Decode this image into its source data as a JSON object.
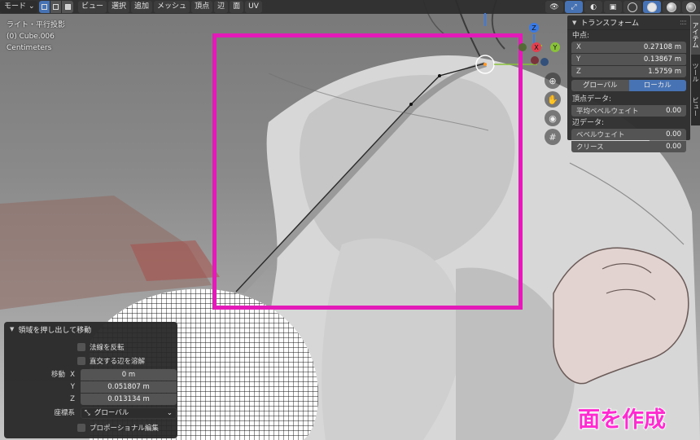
{
  "header": {
    "mode_label": "モード",
    "menus": [
      "ビュー",
      "選択",
      "追加",
      "メッシュ",
      "頂点",
      "辺",
      "面",
      "UV"
    ]
  },
  "viewport_info": {
    "view_name": "ライト・平行投影",
    "object": "(0) Cube.006",
    "units": "Centimeters"
  },
  "gizmo": {
    "axes": [
      "X",
      "Y",
      "Z"
    ],
    "colors": {
      "x": "#e2404f",
      "y": "#89c23a",
      "z": "#3a7ae5"
    }
  },
  "nav_icons": [
    "zoom-icon",
    "hand-icon",
    "camera-icon",
    "grid-icon"
  ],
  "npanel": {
    "title": "トランスフォーム",
    "median_label": "中点:",
    "x_label": "X",
    "x_value": "0.27108 m",
    "y_label": "Y",
    "y_value": "0.13867 m",
    "z_label": "Z",
    "z_value": "1.5759 m",
    "global_label": "グローバル",
    "local_label": "ローカル",
    "vertex_data_label": "頂点データ:",
    "mean_bevel_vertex_label": "平均ベベルウェイト",
    "mean_bevel_vertex_value": "0.00",
    "edge_data_label": "辺データ:",
    "bevel_weight_label": "ベベルウェイト",
    "bevel_weight_value": "0.00",
    "crease_label": "クリース",
    "crease_value": "0.00"
  },
  "sidetabs": [
    "アイテム",
    "ツール",
    "ビュー"
  ],
  "operator": {
    "title": "領域を押し出して移動",
    "flip_normals": "法線を反転",
    "dissolve_orthogonal": "直交する辺を溶解",
    "move_label": "移動",
    "x_label": "X",
    "x_value": "0 m",
    "y_label": "Y",
    "y_value": "0.051807 m",
    "z_label": "Z",
    "z_value": "0.013134 m",
    "orientation_label": "座標系",
    "orientation_value": "グローバル",
    "proportional": "プロポーショナル編集"
  },
  "caption": "面を作成",
  "colors": {
    "accent": "#4772b3",
    "highlight": "#e319b8",
    "caption": "#ff2bd0"
  }
}
